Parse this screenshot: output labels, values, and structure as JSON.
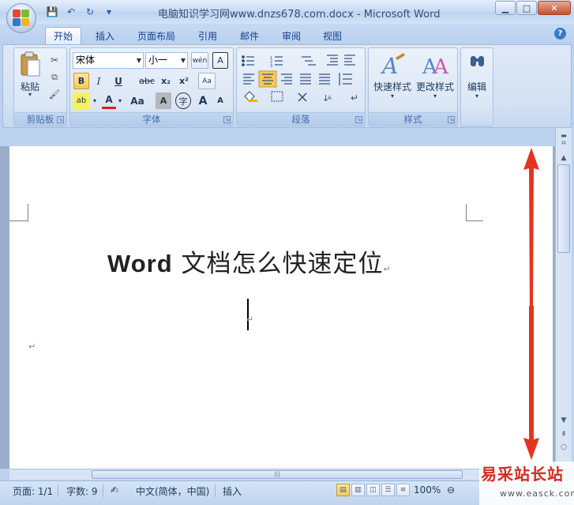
{
  "window": {
    "title": "电脑知识学习网www.dnzs678.com.docx - Microsoft Word",
    "minimize": "▁",
    "maximize": "□",
    "close": "✕"
  },
  "qat": {
    "save": "💾",
    "undo": "↶",
    "redo": "↻",
    "customize": "▾"
  },
  "tabs": [
    "开始",
    "插入",
    "页面布局",
    "引用",
    "邮件",
    "审阅",
    "视图"
  ],
  "help": "?",
  "clipboard": {
    "paste_label": "粘贴",
    "group_label": "剪贴板",
    "cut_icon": "✂",
    "copy_icon": "⧉",
    "format_painter_icon": "🖌"
  },
  "font": {
    "font_name": "宋体",
    "font_size": "小一",
    "group_label": "字体",
    "phonetic": "wén",
    "char_border": "A",
    "bold": "B",
    "italic": "I",
    "underline": "U",
    "strike": "abc",
    "subscript": "x₂",
    "superscript": "x²",
    "clear": "Aa",
    "highlight": "ab",
    "font_color": "A",
    "change_case": "Aa",
    "shading": "A",
    "enclose": "字",
    "grow": "A",
    "shrink": "A"
  },
  "paragraph": {
    "group_label": "段落"
  },
  "styles": {
    "quick_styles": "快速样式",
    "change_styles": "更改样式",
    "group_label": "样式"
  },
  "editing": {
    "label": "编辑"
  },
  "document": {
    "title_latin": "Word",
    "title_cjk": " 文档怎么快速定位",
    "para_mark": "↵"
  },
  "status": {
    "page": "页面: 1/1",
    "words": "字数: 9",
    "language": "中文(简体，中国)",
    "mode": "插入",
    "zoom": "100%"
  },
  "watermark": {
    "main": "易采站长站",
    "url": "www.easck.com"
  },
  "colors": {
    "accent": "#15428b",
    "arrow": "#e53322",
    "watermark": "#d62a1e"
  }
}
